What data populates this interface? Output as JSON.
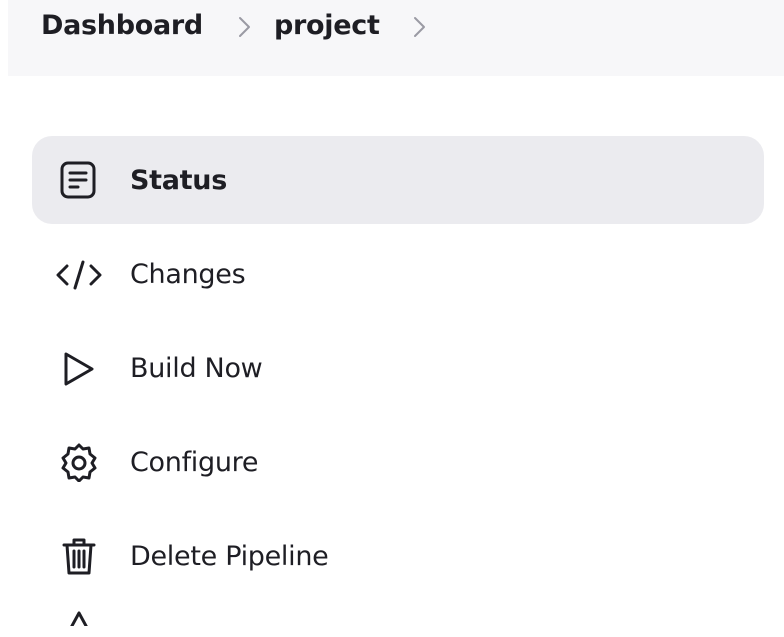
{
  "breadcrumb": {
    "items": [
      {
        "label": "Dashboard"
      },
      {
        "label": "project"
      }
    ]
  },
  "sidebar": {
    "items": [
      {
        "label": "Status",
        "icon": "document-icon",
        "active": true
      },
      {
        "label": "Changes",
        "icon": "code-icon",
        "active": false
      },
      {
        "label": "Build Now",
        "icon": "play-icon",
        "active": false
      },
      {
        "label": "Configure",
        "icon": "gear-icon",
        "active": false
      },
      {
        "label": "Delete Pipeline",
        "icon": "trash-icon",
        "active": false
      },
      {
        "label": "",
        "icon": "warning-icon",
        "active": false
      }
    ]
  },
  "colors": {
    "text": "#1e1e24",
    "breadcrumb_bg": "#f7f7f9",
    "active_bg": "#ebebef",
    "separator": "#9a9aa4"
  }
}
